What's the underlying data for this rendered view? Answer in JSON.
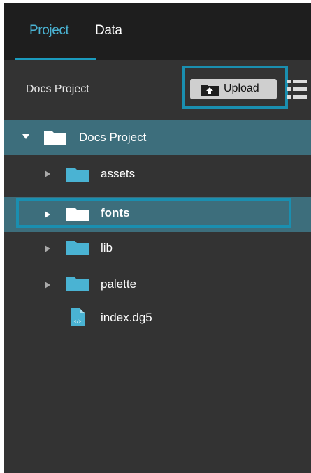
{
  "tabs": [
    {
      "label": "Project",
      "active": true
    },
    {
      "label": "Data",
      "active": false
    }
  ],
  "header": {
    "title": "Docs Project",
    "upload_label": "Upload"
  },
  "tree": {
    "root": {
      "label": "Docs Project",
      "icon": "folder-icon",
      "expanded": true
    },
    "items": [
      {
        "label": "assets",
        "icon": "folder-icon"
      },
      {
        "label": "fonts",
        "icon": "folder-icon",
        "selected": true
      },
      {
        "label": "lib",
        "icon": "folder-icon"
      },
      {
        "label": "palette",
        "icon": "folder-icon"
      },
      {
        "label": "index.dg5",
        "icon": "code-file-icon"
      }
    ]
  },
  "colors": {
    "accent": "#1b9bbd",
    "selection": "#3d6e7c",
    "folder_blue": "#4ab3d3",
    "panel_bg": "#333333",
    "tabbar_bg": "#1e1e1e"
  }
}
